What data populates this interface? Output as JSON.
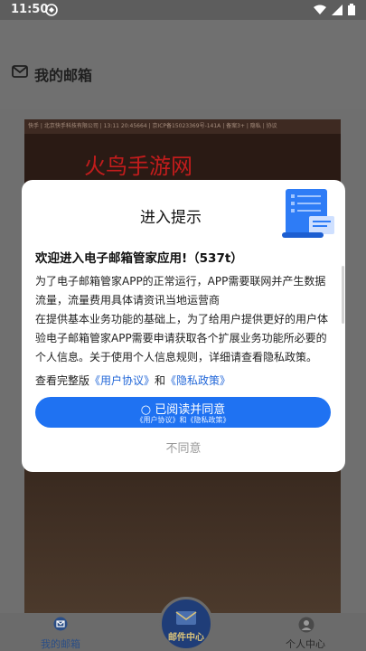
{
  "status_bar": {
    "time": "11:50"
  },
  "header": {
    "title": "我的邮箱",
    "icon": "mail-outline-icon"
  },
  "background_page": {
    "top_line": "快手 | 北京快手科技有限公司 | 13:11 20:45664 | 京ICP备15023369号-141A | 备案3+ | 隐私 | 协议",
    "banner": "火鸟手游网"
  },
  "dialog": {
    "title": "进入提示",
    "heading": "欢迎进入电子邮箱管家应用!（537t）",
    "paragraphs": [
      "为了电子邮箱管家APP的正常运行，APP需要联网并产生数据流量，流量费用具体请资讯当地运营商",
      "在提供基本业务功能的基础上，为了给用户提供更好的用户体验电子邮箱管家APP需要申请获取各个扩展业务功能所必要的个人信息。关于使用个人信息规则，详细请查看隐私政策。"
    ],
    "links_prefix": "查看完整版",
    "user_agreement": "《用户协议》",
    "links_and": "和",
    "privacy_policy": "《隐私政策》",
    "agree_label": "已阅读并同意",
    "agree_sub": "《用户协议》和《隐私政策》",
    "disagree_label": "不同意"
  },
  "tabbar": {
    "tab_mail": "我的邮箱",
    "center": "邮件中心",
    "tab_user": "个人中心"
  },
  "colors": {
    "accent": "#1f72f2",
    "link": "#2267d8"
  }
}
